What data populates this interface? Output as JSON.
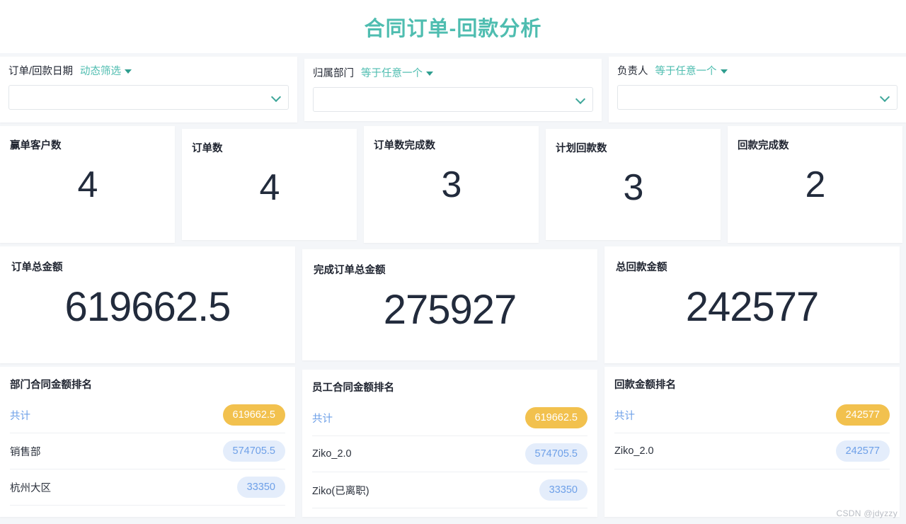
{
  "header": {
    "title": "合同订单-回款分析",
    "accent_color": "#4fbdb0"
  },
  "filters": [
    {
      "label": "订单/回款日期",
      "mode": "动态筛选",
      "value": "",
      "caret_icon": "caret-down-icon",
      "chevron_icon": "chevron-down-icon"
    },
    {
      "label": "归属部门",
      "mode": "等于任意一个",
      "value": "",
      "caret_icon": "caret-down-icon",
      "chevron_icon": "chevron-down-icon"
    },
    {
      "label": "负责人",
      "mode": "等于任意一个",
      "value": "",
      "caret_icon": "caret-down-icon",
      "chevron_icon": "chevron-down-icon"
    }
  ],
  "kpis": [
    {
      "title": "赢单客户数",
      "value": "4"
    },
    {
      "title": "订单数",
      "value": "4"
    },
    {
      "title": "订单数完成数",
      "value": "3"
    },
    {
      "title": "计划回款数",
      "value": "3"
    },
    {
      "title": "回款完成数",
      "value": "2"
    }
  ],
  "amounts": [
    {
      "title": "订单总金额",
      "value": "619662.5"
    },
    {
      "title": "完成订单总金额",
      "value": "275927"
    },
    {
      "title": "总回款金额",
      "value": "242577"
    }
  ],
  "rankings": [
    {
      "title": "部门合同金额排名",
      "rows": [
        {
          "name": "共计",
          "value": "619662.5",
          "style": "total"
        },
        {
          "name": "销售部",
          "value": "574705.5",
          "style": "normal"
        },
        {
          "name": "杭州大区",
          "value": "33350",
          "style": "normal"
        }
      ]
    },
    {
      "title": "员工合同金额排名",
      "rows": [
        {
          "name": "共计",
          "value": "619662.5",
          "style": "total"
        },
        {
          "name": "Ziko_2.0",
          "value": "574705.5",
          "style": "normal"
        },
        {
          "name": "Ziko(已离职)",
          "value": "33350",
          "style": "normal"
        }
      ]
    },
    {
      "title": "回款金额排名",
      "rows": [
        {
          "name": "共计",
          "value": "242577",
          "style": "total"
        },
        {
          "name": "Ziko_2.0",
          "value": "242577",
          "style": "normal"
        }
      ]
    }
  ],
  "watermark": "CSDN @jdyzzy",
  "colors": {
    "accent_teal": "#4fbdb0",
    "pill_yellow": "#f2c14e",
    "pill_blue_bg": "#e4edfb",
    "pill_blue_text": "#6ea0e8",
    "value_dark": "#222b3c",
    "page_bg": "#f4f6f9"
  }
}
